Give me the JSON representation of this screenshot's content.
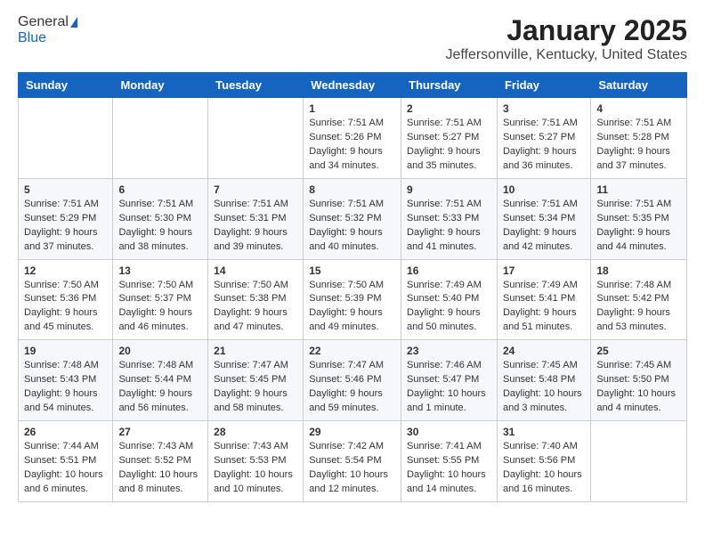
{
  "header": {
    "logo_general": "General",
    "logo_blue": "Blue",
    "main_title": "January 2025",
    "subtitle": "Jeffersonville, Kentucky, United States"
  },
  "days_of_week": [
    "Sunday",
    "Monday",
    "Tuesday",
    "Wednesday",
    "Thursday",
    "Friday",
    "Saturday"
  ],
  "weeks": [
    [
      {
        "num": "",
        "info": ""
      },
      {
        "num": "",
        "info": ""
      },
      {
        "num": "",
        "info": ""
      },
      {
        "num": "1",
        "info": "Sunrise: 7:51 AM\nSunset: 5:26 PM\nDaylight: 9 hours\nand 34 minutes."
      },
      {
        "num": "2",
        "info": "Sunrise: 7:51 AM\nSunset: 5:27 PM\nDaylight: 9 hours\nand 35 minutes."
      },
      {
        "num": "3",
        "info": "Sunrise: 7:51 AM\nSunset: 5:27 PM\nDaylight: 9 hours\nand 36 minutes."
      },
      {
        "num": "4",
        "info": "Sunrise: 7:51 AM\nSunset: 5:28 PM\nDaylight: 9 hours\nand 37 minutes."
      }
    ],
    [
      {
        "num": "5",
        "info": "Sunrise: 7:51 AM\nSunset: 5:29 PM\nDaylight: 9 hours\nand 37 minutes."
      },
      {
        "num": "6",
        "info": "Sunrise: 7:51 AM\nSunset: 5:30 PM\nDaylight: 9 hours\nand 38 minutes."
      },
      {
        "num": "7",
        "info": "Sunrise: 7:51 AM\nSunset: 5:31 PM\nDaylight: 9 hours\nand 39 minutes."
      },
      {
        "num": "8",
        "info": "Sunrise: 7:51 AM\nSunset: 5:32 PM\nDaylight: 9 hours\nand 40 minutes."
      },
      {
        "num": "9",
        "info": "Sunrise: 7:51 AM\nSunset: 5:33 PM\nDaylight: 9 hours\nand 41 minutes."
      },
      {
        "num": "10",
        "info": "Sunrise: 7:51 AM\nSunset: 5:34 PM\nDaylight: 9 hours\nand 42 minutes."
      },
      {
        "num": "11",
        "info": "Sunrise: 7:51 AM\nSunset: 5:35 PM\nDaylight: 9 hours\nand 44 minutes."
      }
    ],
    [
      {
        "num": "12",
        "info": "Sunrise: 7:50 AM\nSunset: 5:36 PM\nDaylight: 9 hours\nand 45 minutes."
      },
      {
        "num": "13",
        "info": "Sunrise: 7:50 AM\nSunset: 5:37 PM\nDaylight: 9 hours\nand 46 minutes."
      },
      {
        "num": "14",
        "info": "Sunrise: 7:50 AM\nSunset: 5:38 PM\nDaylight: 9 hours\nand 47 minutes."
      },
      {
        "num": "15",
        "info": "Sunrise: 7:50 AM\nSunset: 5:39 PM\nDaylight: 9 hours\nand 49 minutes."
      },
      {
        "num": "16",
        "info": "Sunrise: 7:49 AM\nSunset: 5:40 PM\nDaylight: 9 hours\nand 50 minutes."
      },
      {
        "num": "17",
        "info": "Sunrise: 7:49 AM\nSunset: 5:41 PM\nDaylight: 9 hours\nand 51 minutes."
      },
      {
        "num": "18",
        "info": "Sunrise: 7:48 AM\nSunset: 5:42 PM\nDaylight: 9 hours\nand 53 minutes."
      }
    ],
    [
      {
        "num": "19",
        "info": "Sunrise: 7:48 AM\nSunset: 5:43 PM\nDaylight: 9 hours\nand 54 minutes."
      },
      {
        "num": "20",
        "info": "Sunrise: 7:48 AM\nSunset: 5:44 PM\nDaylight: 9 hours\nand 56 minutes."
      },
      {
        "num": "21",
        "info": "Sunrise: 7:47 AM\nSunset: 5:45 PM\nDaylight: 9 hours\nand 58 minutes."
      },
      {
        "num": "22",
        "info": "Sunrise: 7:47 AM\nSunset: 5:46 PM\nDaylight: 9 hours\nand 59 minutes."
      },
      {
        "num": "23",
        "info": "Sunrise: 7:46 AM\nSunset: 5:47 PM\nDaylight: 10 hours\nand 1 minute."
      },
      {
        "num": "24",
        "info": "Sunrise: 7:45 AM\nSunset: 5:48 PM\nDaylight: 10 hours\nand 3 minutes."
      },
      {
        "num": "25",
        "info": "Sunrise: 7:45 AM\nSunset: 5:50 PM\nDaylight: 10 hours\nand 4 minutes."
      }
    ],
    [
      {
        "num": "26",
        "info": "Sunrise: 7:44 AM\nSunset: 5:51 PM\nDaylight: 10 hours\nand 6 minutes."
      },
      {
        "num": "27",
        "info": "Sunrise: 7:43 AM\nSunset: 5:52 PM\nDaylight: 10 hours\nand 8 minutes."
      },
      {
        "num": "28",
        "info": "Sunrise: 7:43 AM\nSunset: 5:53 PM\nDaylight: 10 hours\nand 10 minutes."
      },
      {
        "num": "29",
        "info": "Sunrise: 7:42 AM\nSunset: 5:54 PM\nDaylight: 10 hours\nand 12 minutes."
      },
      {
        "num": "30",
        "info": "Sunrise: 7:41 AM\nSunset: 5:55 PM\nDaylight: 10 hours\nand 14 minutes."
      },
      {
        "num": "31",
        "info": "Sunrise: 7:40 AM\nSunset: 5:56 PM\nDaylight: 10 hours\nand 16 minutes."
      },
      {
        "num": "",
        "info": ""
      }
    ]
  ]
}
